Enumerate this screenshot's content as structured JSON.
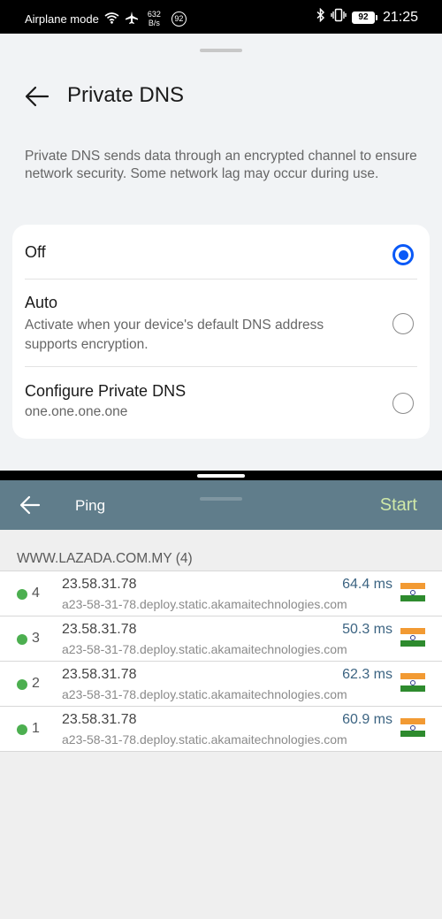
{
  "status_bar": {
    "airplane_mode_label": "Airplane mode",
    "net_speed_value": "632",
    "net_speed_unit": "B/s",
    "notification_count": "92",
    "battery_level": "92",
    "time": "21:25",
    "icons": [
      "wifi-icon",
      "airplane-icon",
      "bluetooth-icon",
      "vibrate-icon",
      "battery-icon"
    ]
  },
  "settings": {
    "title": "Private DNS",
    "description": "Private DNS sends data through an encrypted channel to ensure network security. Some network lag may occur during use.",
    "options": [
      {
        "title": "Off",
        "subtitle": "",
        "selected": true
      },
      {
        "title": "Auto",
        "subtitle": "Activate when your device's default DNS address supports encryption.",
        "selected": false
      },
      {
        "title": "Configure Private DNS",
        "subtitle": "one.one.one.one",
        "selected": false
      }
    ],
    "accent_color": "#0a59f7"
  },
  "ping_app": {
    "title": "Ping",
    "start_label": "Start",
    "appbar_color": "#607d8b",
    "host_header": "WWW.LAZADA.COM.MY (4)",
    "results": [
      {
        "seq": "4",
        "ip": "23.58.31.78",
        "host": "a23-58-31-78.deploy.static.akamaitechnologies.com",
        "time": "64.4 ms",
        "flag": "india-flag-icon"
      },
      {
        "seq": "3",
        "ip": "23.58.31.78",
        "host": "a23-58-31-78.deploy.static.akamaitechnologies.com",
        "time": "50.3 ms",
        "flag": "india-flag-icon"
      },
      {
        "seq": "2",
        "ip": "23.58.31.78",
        "host": "a23-58-31-78.deploy.static.akamaitechnologies.com",
        "time": "62.3 ms",
        "flag": "india-flag-icon"
      },
      {
        "seq": "1",
        "ip": "23.58.31.78",
        "host": "a23-58-31-78.deploy.static.akamaitechnologies.com",
        "time": "60.9 ms",
        "flag": "india-flag-icon"
      }
    ],
    "status_dot_color": "#4caf50"
  }
}
